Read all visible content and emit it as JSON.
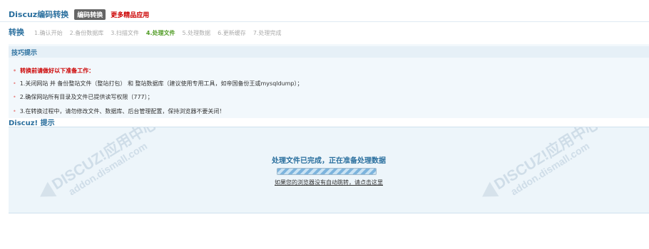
{
  "header": {
    "title": "Discuz编码转换",
    "badge": "编码转换",
    "more_link": "更多精品应用"
  },
  "steps": {
    "title": "转换",
    "items": [
      {
        "label": "1.确认开始",
        "current": false
      },
      {
        "label": "2.备份数据库",
        "current": false
      },
      {
        "label": "3.扫描文件",
        "current": false
      },
      {
        "label": "4.处理文件",
        "current": true
      },
      {
        "label": "5.处理数据",
        "current": false
      },
      {
        "label": "6.更新缓存",
        "current": false
      },
      {
        "label": "7.处理完成",
        "current": false
      }
    ]
  },
  "tips": {
    "title": "技巧提示",
    "items": [
      "转换前请做好以下准备工作：",
      "1.关闭网站 并 备份整站文件（整站打包） 和 整站数据库（建议使用专用工具，如帝国备份王或mysqldump）；",
      "2.确保网站所有目录及文件已提供读写权限（777）；",
      "3.在转换过程中，请勿修改文件、数据库、后台管理配置，保持浏览器不要关闭！"
    ]
  },
  "notice": {
    "title": "Discuz! 提示",
    "message": "处理文件已完成，正在准备处理数据",
    "redirect_link": "如果您的浏览器没有自动跳转，请点击这里",
    "progress_percent": 100
  },
  "watermark": {
    "brand_text": "DISCUZ!应用中心 | 贰道",
    "url_text": "addon.dismall.com"
  },
  "colors": {
    "accent": "#2a6f9e",
    "warning": "#cc0000",
    "current_step": "#4f9b23",
    "panel_bg": "#edf5fa"
  }
}
